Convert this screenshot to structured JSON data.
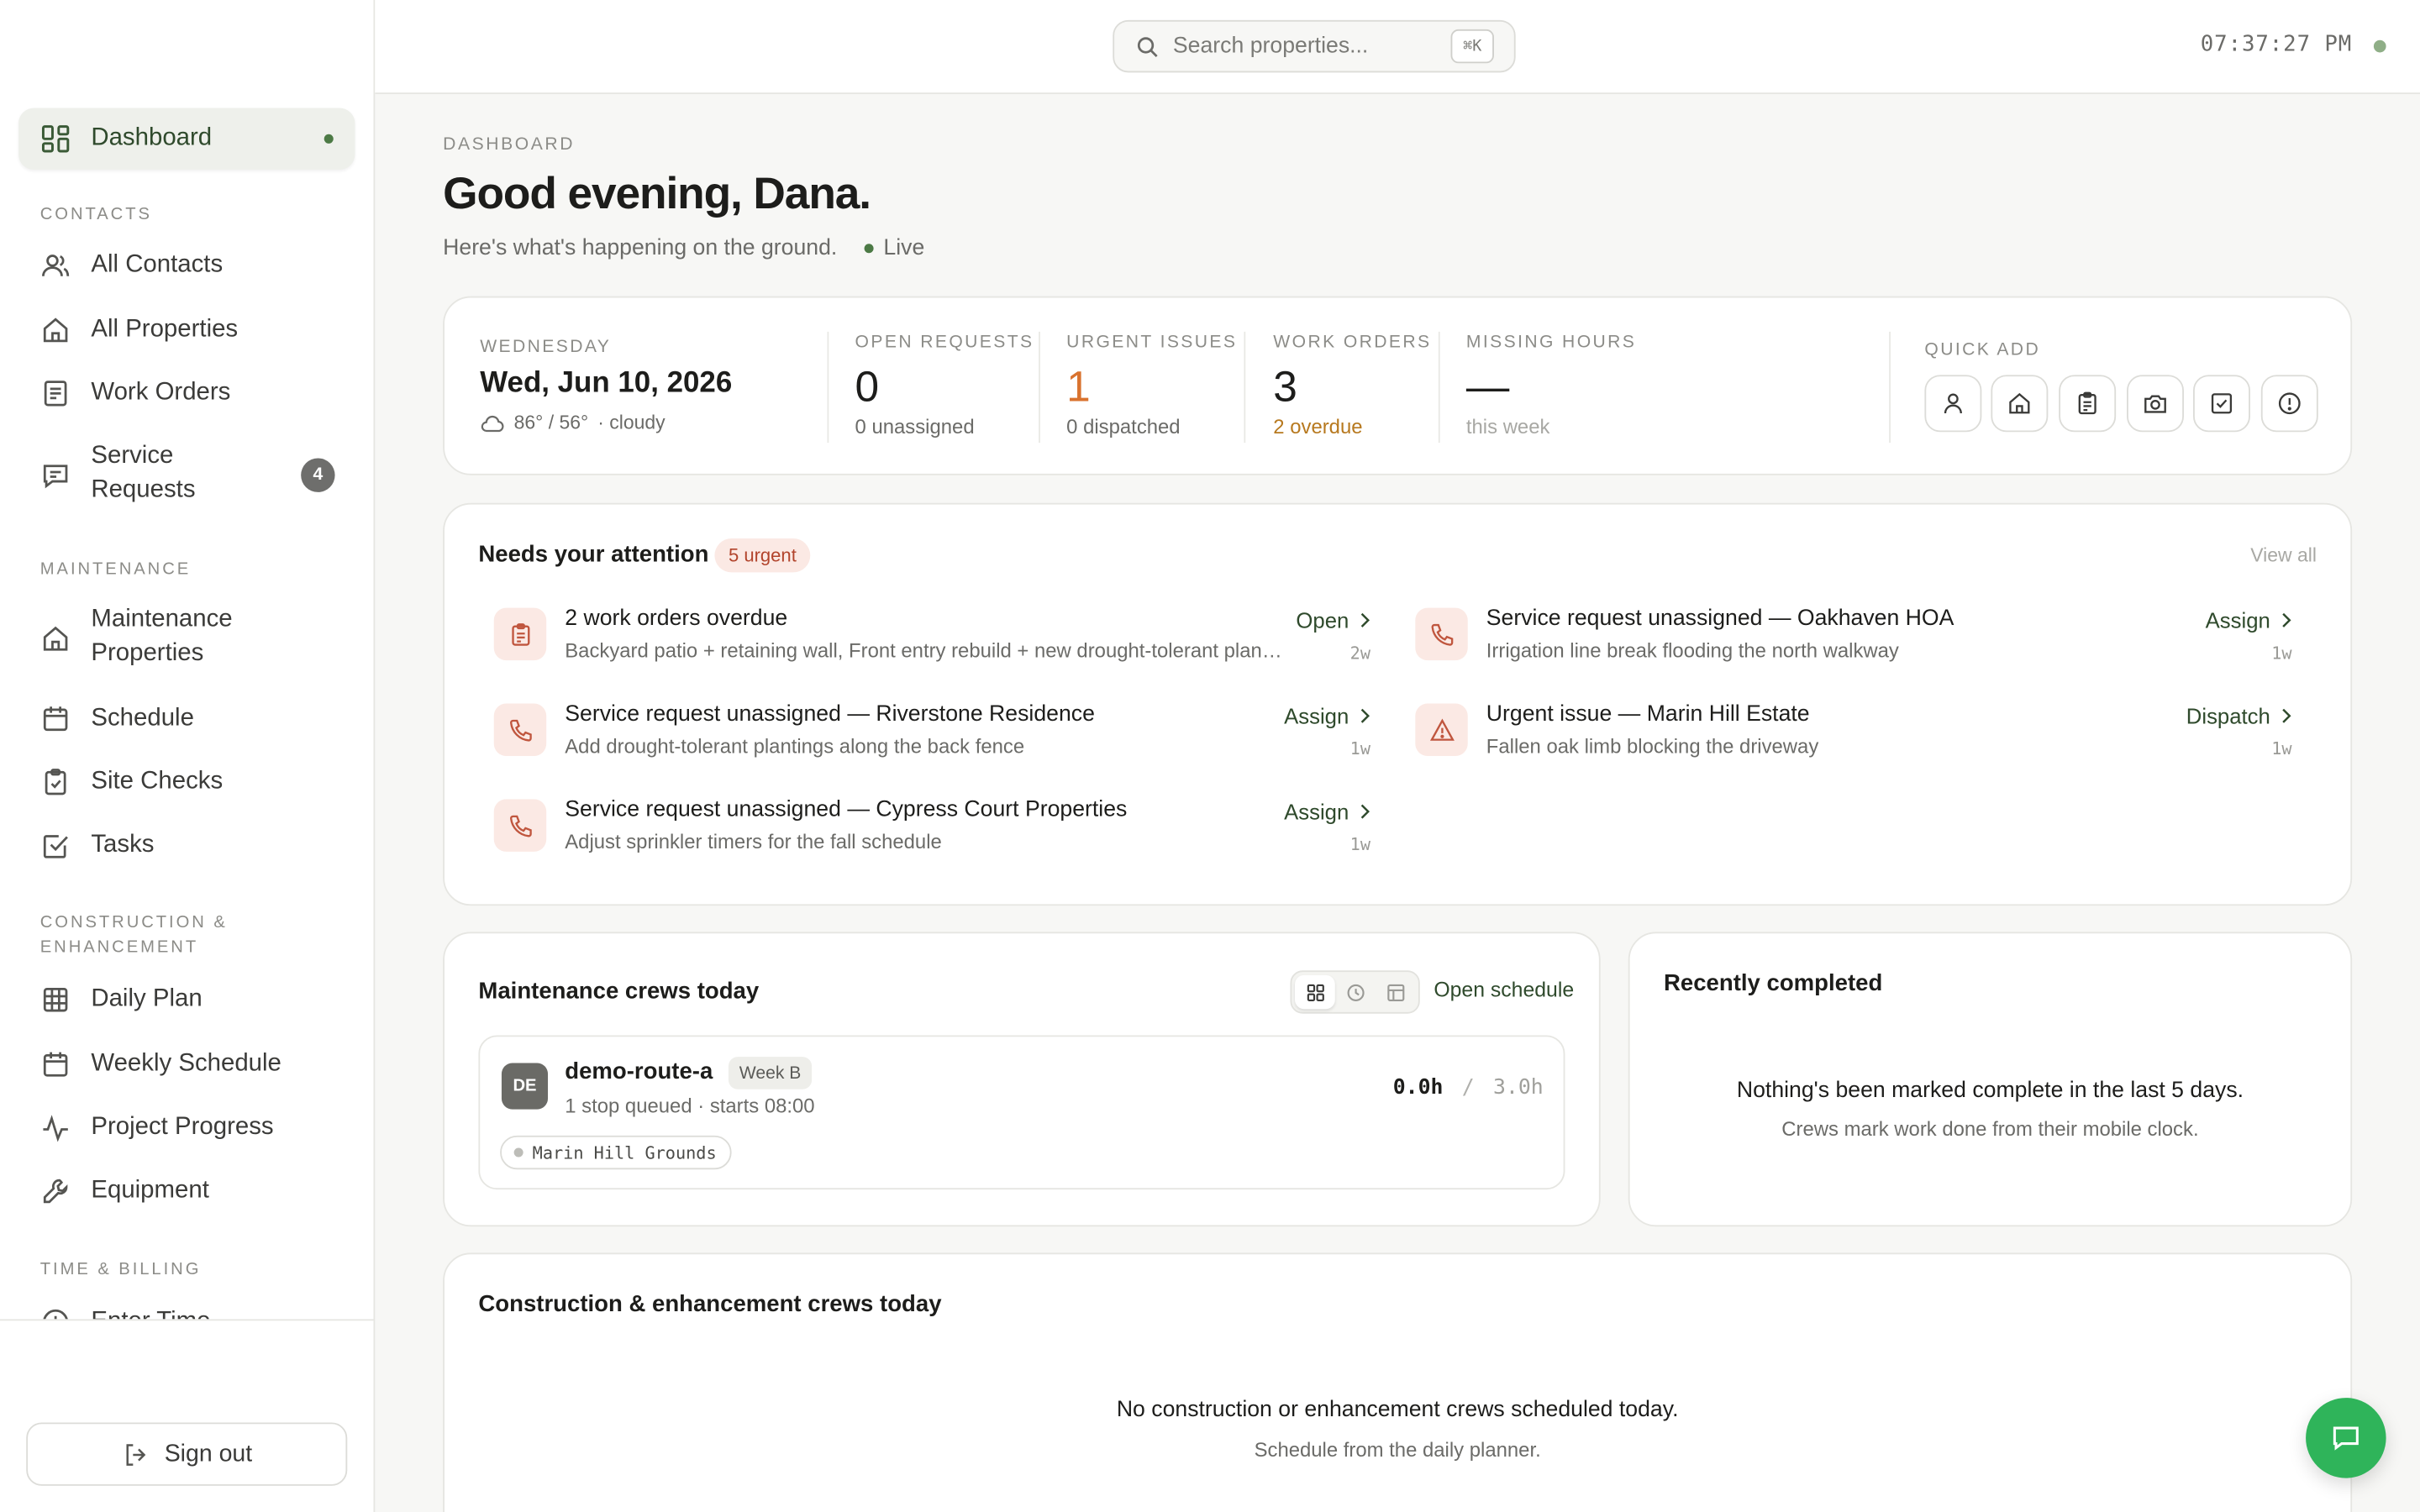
{
  "sidebar": {
    "dashboard": "Dashboard",
    "sections": {
      "contacts": "CONTACTS",
      "maintenance": "MAINTENANCE",
      "construction_1": "CONSTRUCTION &",
      "construction_2": "ENHANCEMENT",
      "time_billing": "TIME & BILLING"
    },
    "items": {
      "all_contacts": "All Contacts",
      "all_properties": "All Properties",
      "work_orders": "Work Orders",
      "service_requests_1": "Service",
      "service_requests_2": "Requests",
      "service_requests_badge": "4",
      "maintenance_properties_1": "Maintenance",
      "maintenance_properties_2": "Properties",
      "schedule": "Schedule",
      "site_checks": "Site Checks",
      "tasks": "Tasks",
      "daily_plan": "Daily Plan",
      "weekly_schedule": "Weekly Schedule",
      "project_progress": "Project Progress",
      "equipment": "Equipment",
      "enter_time": "Enter Time"
    },
    "sign_out": "Sign out"
  },
  "topbar": {
    "search_placeholder": "Search properties...",
    "shortcut": "⌘K",
    "clock": "07:37:27 PM"
  },
  "header": {
    "eyebrow": "DASHBOARD",
    "greeting": "Good evening, Dana.",
    "subtitle": "Here's what's happening on the ground.",
    "live": "Live"
  },
  "stats": {
    "day_label": "WEDNESDAY",
    "date": "Wed, Jun 10, 2026",
    "weather": "86° / 56°",
    "condition": "· cloudy",
    "open_requests": {
      "label": "OPEN REQUESTS",
      "value": "0",
      "sub": "0 unassigned"
    },
    "urgent_issues": {
      "label": "URGENT ISSUES",
      "value": "1",
      "sub": "0 dispatched"
    },
    "work_orders": {
      "label": "WORK ORDERS",
      "value": "3",
      "sub": "2 overdue"
    },
    "missing_hours": {
      "label": "MISSING HOURS",
      "value": "—",
      "sub": "this week"
    },
    "quick_add": "QUICK ADD"
  },
  "attention": {
    "title": "Needs your attention",
    "badge": "5 urgent",
    "view_all": "View all",
    "items": [
      {
        "title": "2 work orders overdue",
        "desc": "Backyard patio + retaining wall, Front entry rebuild + new drought-tolerant planting",
        "action": "Open",
        "age": "2w"
      },
      {
        "title": "Service request unassigned — Oakhaven HOA",
        "desc": "Irrigation line break flooding the north walkway",
        "action": "Assign",
        "age": "1w"
      },
      {
        "title": "Service request unassigned — Riverstone Residence",
        "desc": "Add drought-tolerant plantings along the back fence",
        "action": "Assign",
        "age": "1w"
      },
      {
        "title": "Urgent issue — Marin Hill Estate",
        "desc": "Fallen oak limb blocking the driveway",
        "action": "Dispatch",
        "age": "1w"
      },
      {
        "title": "Service request unassigned — Cypress Court Properties",
        "desc": "Adjust sprinkler timers for the fall schedule",
        "action": "Assign",
        "age": "1w"
      }
    ]
  },
  "maintenance_crews": {
    "title": "Maintenance crews today",
    "open_schedule": "Open schedule",
    "crew": {
      "initials": "DE",
      "name": "demo-route-a",
      "week": "Week B",
      "sub": "1 stop queued · starts 08:00",
      "hours_done": "0.0h",
      "hours_sep": "/",
      "hours_total": "3.0h",
      "stop": "Marin Hill Grounds"
    }
  },
  "recently_completed": {
    "title": "Recently completed",
    "empty_title": "Nothing's been marked complete in the last 5 days.",
    "empty_sub": "Crews mark work done from their mobile clock."
  },
  "construction_crews": {
    "title": "Construction & enhancement crews today",
    "empty_title": "No construction or enhancement crews scheduled today.",
    "empty_sub": "Schedule from the daily planner."
  },
  "colors": {
    "accent_green": "#2f4a2c",
    "urgent_orange": "#d9722e",
    "overdue_amber": "#b7791f",
    "fab_green": "#2fb45a"
  }
}
